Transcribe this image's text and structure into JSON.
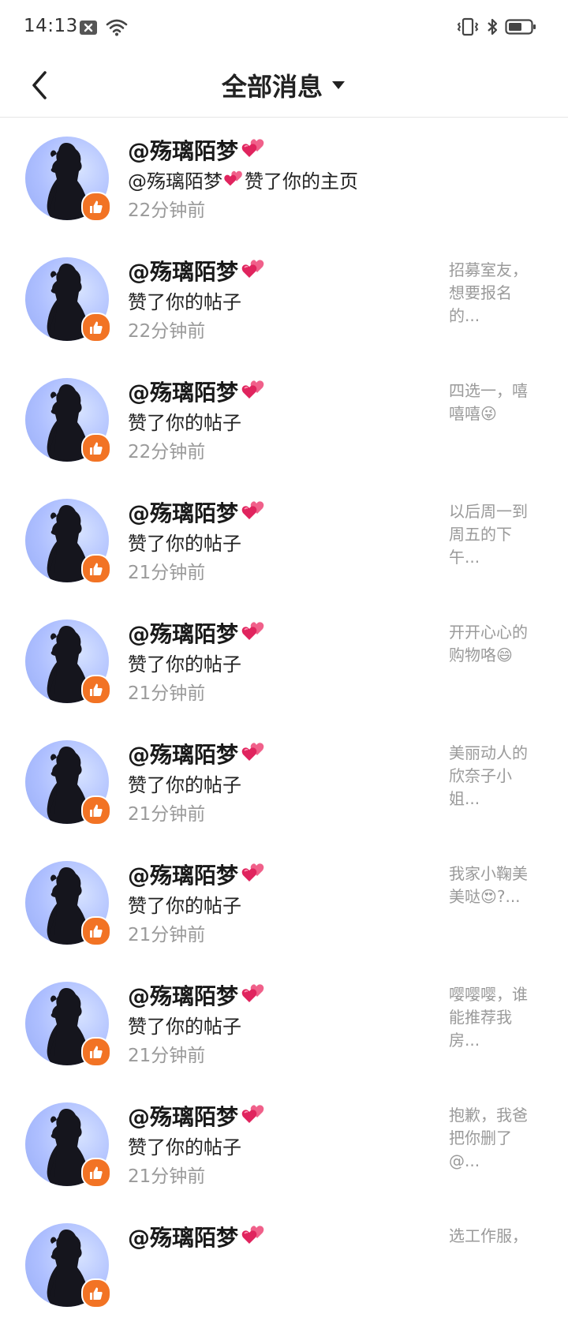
{
  "status_bar": {
    "time": "14:13"
  },
  "header": {
    "title": "全部消息"
  },
  "items": [
    {
      "username": "@殇璃陌梦",
      "action_before": "@殇璃陌梦",
      "action_after": "赞了你的主页",
      "action": "赞了你的主页",
      "time": "22分钟前",
      "preview": "",
      "kind": "profile"
    },
    {
      "username": "@殇璃陌梦",
      "action": "赞了你的帖子",
      "time": "22分钟前",
      "preview": "招募室友，想要报名的..."
    },
    {
      "username": "@殇璃陌梦",
      "action": "赞了你的帖子",
      "time": "22分钟前",
      "preview": "四选一，嘻嘻嘻😜"
    },
    {
      "username": "@殇璃陌梦",
      "action": "赞了你的帖子",
      "time": "21分钟前",
      "preview": "以后周一到周五的下午..."
    },
    {
      "username": "@殇璃陌梦",
      "action": "赞了你的帖子",
      "time": "21分钟前",
      "preview": "开开心心的购物咯😄"
    },
    {
      "username": "@殇璃陌梦",
      "action": "赞了你的帖子",
      "time": "21分钟前",
      "preview": "美丽动人的欣奈子小姐..."
    },
    {
      "username": "@殇璃陌梦",
      "action": "赞了你的帖子",
      "time": "21分钟前",
      "preview": "我家小鞠美美哒😍?..."
    },
    {
      "username": "@殇璃陌梦",
      "action": "赞了你的帖子",
      "time": "21分钟前",
      "preview": "嘤嘤嘤，谁能推荐我房..."
    },
    {
      "username": "@殇璃陌梦",
      "action": "赞了你的帖子",
      "time": "21分钟前",
      "preview": "抱歉，我爸把你删了@..."
    },
    {
      "username": "@殇璃陌梦",
      "action": "",
      "time": "",
      "preview": "选工作服，"
    }
  ],
  "colors": {
    "accent": "#f27324",
    "avatar_bg": "#aebfff",
    "muted_text": "#9a9a9a"
  },
  "icons": {
    "back": "chevron-left-icon",
    "dropdown": "caret-down-icon",
    "like_badge": "thumbs-up-icon",
    "name_suffix": "two-hearts-emoji"
  }
}
